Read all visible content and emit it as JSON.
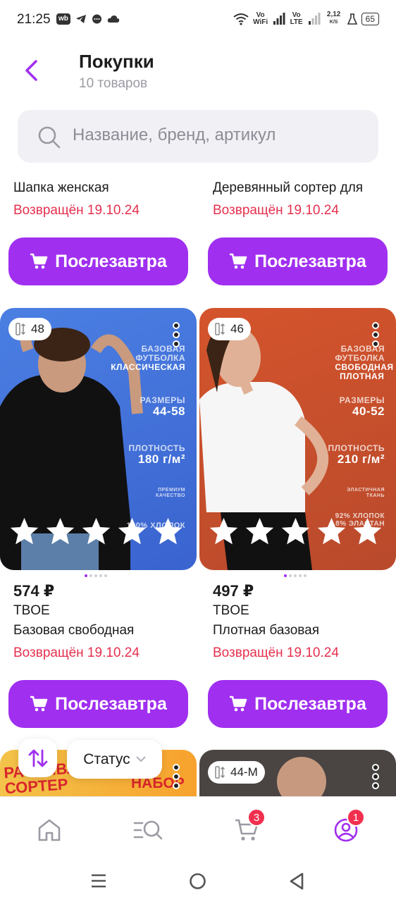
{
  "status_bar": {
    "time": "21:25",
    "wb_label": "wb",
    "vowifi": "Vo WiFi",
    "volte": "Vo LTE",
    "speed_value": "2,12",
    "speed_unit": "K/S",
    "battery": "65"
  },
  "header": {
    "title": "Покупки",
    "subtitle": "10 товаров"
  },
  "search": {
    "placeholder": "Название, бренд, артикул"
  },
  "delivery_button_label": "Послезавтра",
  "products_row1": [
    {
      "name": "Шапка женская",
      "status": "Возвращён 19.10.24"
    },
    {
      "name": "Деревянный сортер для",
      "status": "Возвращён 19.10.24"
    }
  ],
  "products_row2": [
    {
      "sizes_count": "48",
      "price": "574 ₽",
      "brand": "TBOE",
      "name": "Базовая свободная",
      "status": "Возвращён 19.10.24",
      "overlay": {
        "line1": "БАЗОВАЯ",
        "line2": "ФУТБОЛКА",
        "line3": "КЛАССИЧЕСКАЯ",
        "sizes_label": "РАЗМЕРЫ",
        "sizes_value": "44-58",
        "density_label": "ПЛОТНОСТЬ",
        "density_value": "180 г/м²",
        "extra": "ПРЕМИУМ КАЧЕСТВО",
        "cotton": "100% ХЛОПОК"
      },
      "rating_stars": 5,
      "image_bg": "#4b7fe2"
    },
    {
      "sizes_count": "46",
      "price": "497 ₽",
      "brand": "TBOE",
      "name": "Плотная базовая",
      "status": "Возвращён 19.10.24",
      "overlay": {
        "line1": "БАЗОВАЯ",
        "line2": "ФУТБОЛКА",
        "line3": "СВОБОДНАЯ ПЛОТНАЯ",
        "sizes_label": "РАЗМЕРЫ",
        "sizes_value": "40-52",
        "density_label": "ПЛОТНОСТЬ",
        "density_value": "210 г/м²",
        "extra": "ЭЛАСТИЧНАЯ ТКАНЬ",
        "cotton": "92% ХЛОПОК 8% ЭЛАСТАН"
      },
      "rating_stars": 5,
      "image_bg": "#d4542c"
    }
  ],
  "products_row3": [
    {
      "image_text_line1": "РАЗВИВАЮЩИЙ",
      "image_text_line2": "СОРТЕР",
      "image_text_side": "НАБОР"
    },
    {
      "sizes_count": "44-M"
    }
  ],
  "filter": {
    "status_label": "Статус"
  },
  "bottom_nav": {
    "cart_badge": "3",
    "profile_badge": "1"
  },
  "colors": {
    "accent": "#a02ff0",
    "returned": "#e5304e",
    "badge": "#f0304e"
  }
}
